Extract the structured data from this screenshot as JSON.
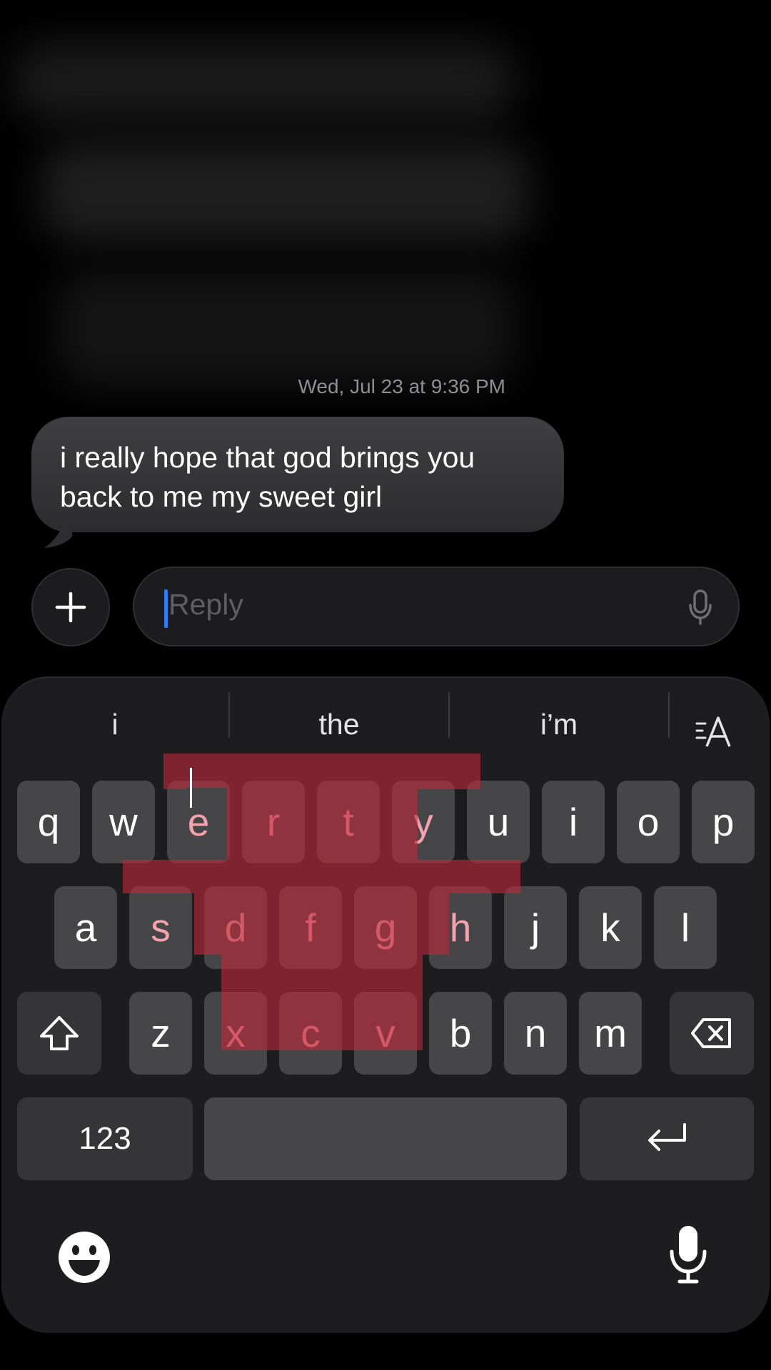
{
  "conversation": {
    "timestamp": "Wed, Jul 23 at 9:36 PM",
    "message": "i really hope that god brings you back to me my sweet girl"
  },
  "input": {
    "placeholder": "Reply",
    "plus_icon": "plus-icon",
    "mic_icon": "microphone-icon"
  },
  "keyboard": {
    "suggestions": [
      "i",
      "the",
      "i’m"
    ],
    "format_icon": "text-format-icon",
    "row1": [
      "q",
      "w",
      "e",
      "r",
      "t",
      "y",
      "u",
      "i",
      "o",
      "p"
    ],
    "row2": [
      "a",
      "s",
      "d",
      "f",
      "g",
      "h",
      "j",
      "k",
      "l"
    ],
    "row3": [
      "z",
      "x",
      "c",
      "v",
      "b",
      "n",
      "m"
    ],
    "numbers_label": "123",
    "shift_icon": "shift-icon",
    "delete_icon": "delete-icon",
    "return_icon": "return-icon",
    "emoji_icon": "emoji-icon",
    "dictation_icon": "microphone-icon",
    "highlight_color": "#c0283a",
    "highlighted_keys": [
      "e",
      "r",
      "t",
      "y",
      "s",
      "d",
      "f",
      "g",
      "h",
      "x",
      "c",
      "v"
    ]
  }
}
